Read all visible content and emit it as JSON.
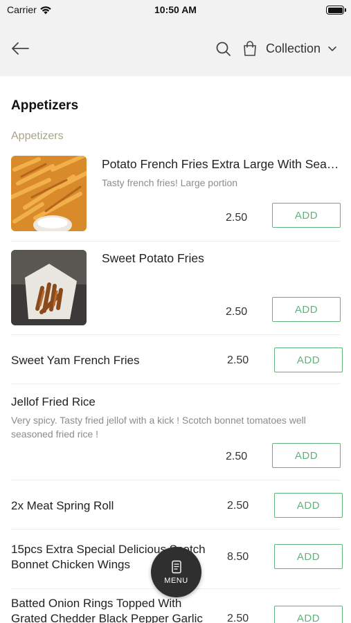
{
  "status_bar": {
    "carrier": "Carrier",
    "time": "10:50 AM"
  },
  "nav": {
    "back_icon": "arrow-left-icon",
    "search_icon": "search-icon",
    "bag_icon": "shopping-bag-icon",
    "collection_label": "Collection",
    "chevron_icon": "chevron-down-icon"
  },
  "section": {
    "title": "Appetizers",
    "category": "Appetizers"
  },
  "add_label": "ADD",
  "items": [
    {
      "name": "Potato French Fries Extra Large With Sea…",
      "desc": "Tasty french fries! Large portion",
      "price": "2.50",
      "image": "french-fries-image"
    },
    {
      "name": "Sweet Potato Fries",
      "desc": "",
      "price": "2.50",
      "image": "sweet-potato-fries-image"
    },
    {
      "name": "Sweet Yam French Fries",
      "desc": "",
      "price": "2.50"
    },
    {
      "name": "Jellof Fried Rice",
      "desc": "Very spicy. Tasty fried jellof with a kick ! Scotch bonnet tomatoes well seasoned fried rice !",
      "price": "2.50"
    },
    {
      "name": "2x Meat Spring Roll",
      "desc": "",
      "price": "2.50"
    },
    {
      "name_line1": "15pcs Extra Special Delicious Scotch",
      "name_line2": "Bonnet Chicken Wings",
      "price": "8.50"
    },
    {
      "name_line1": "Batted Onion Rings Topped With",
      "name_line2": "Grated Chedder Black Pepper Garlic",
      "price": "2.50"
    }
  ],
  "menu_fab": {
    "label": "MENU",
    "icon": "menu-book-icon"
  },
  "colors": {
    "accent_green": "#5fb37a",
    "category_label": "#a7a587",
    "nav_background": "#f2f2f2",
    "fab_background": "#2f2f2f"
  }
}
